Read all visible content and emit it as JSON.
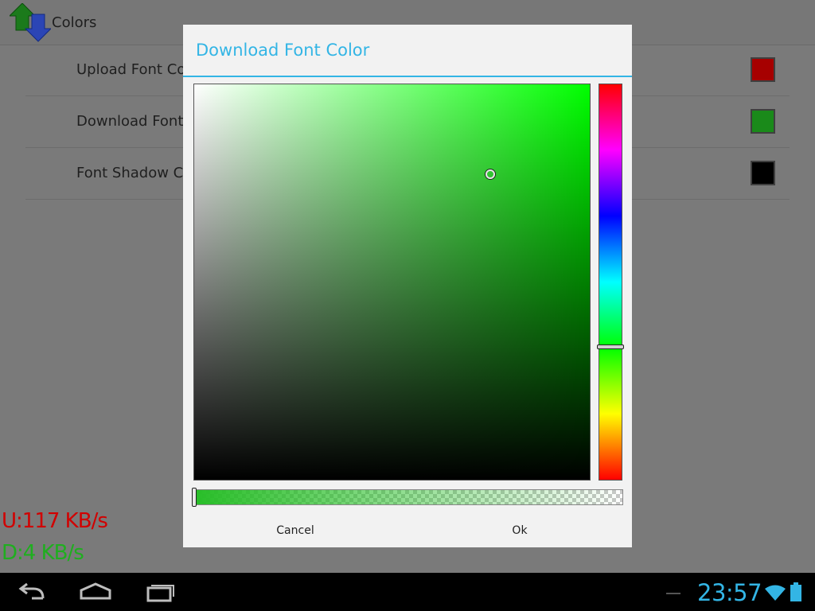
{
  "app": {
    "title": "Colors"
  },
  "prefs": [
    {
      "label": "Upload Font Colo",
      "swatch": "#a60000"
    },
    {
      "label": "Download Font C",
      "swatch": "#1a8a1a"
    },
    {
      "label": "Font Shadow Col",
      "swatch": "#000000"
    }
  ],
  "overlay": {
    "upload": "U:117 KB/s",
    "download": "D:4 KB/s"
  },
  "dialog": {
    "title": "Download Font Color",
    "cancel_label": "Cancel",
    "ok_label": "Ok",
    "hue_color": "#00ff00",
    "selected_color": "#28be28"
  },
  "statusbar": {
    "time": "23:57"
  },
  "icons": [
    "app-arrows-icon",
    "back-icon",
    "home-icon",
    "recent-apps-icon",
    "wifi-icon",
    "battery-icon"
  ]
}
